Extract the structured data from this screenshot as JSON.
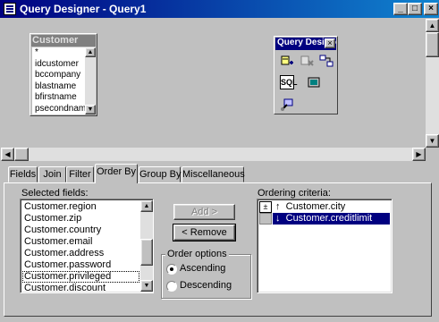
{
  "window": {
    "title": "Query Designer - Query1"
  },
  "table_box": {
    "title": "Customer",
    "fields": [
      "*",
      "idcustomer",
      "bccompany",
      "blastname",
      "bfirstname",
      "psecondname"
    ]
  },
  "toolbox": {
    "title": "Query Designer",
    "sql_label": "SQL"
  },
  "tabs": [
    "Fields",
    "Join",
    "Filter",
    "Order By",
    "Group By",
    "Miscellaneous"
  ],
  "order_by": {
    "selected_fields_label": "Selected fields:",
    "selected_fields": [
      "Customer.region",
      "Customer.zip",
      "Customer.country",
      "Customer.email",
      "Customer.address",
      "Customer.password",
      "Customer.privileged",
      "Customer.discount"
    ],
    "add_label": "Add >",
    "remove_label": "< Remove",
    "order_options_label": "Order options",
    "ascending_label": "Ascending",
    "descending_label": "Descending",
    "ordering_criteria_label": "Ordering criteria:",
    "criteria": [
      {
        "direction": "↑",
        "field": "Customer.city"
      },
      {
        "direction": "↓",
        "field": "Customer.creditlimit"
      }
    ]
  }
}
